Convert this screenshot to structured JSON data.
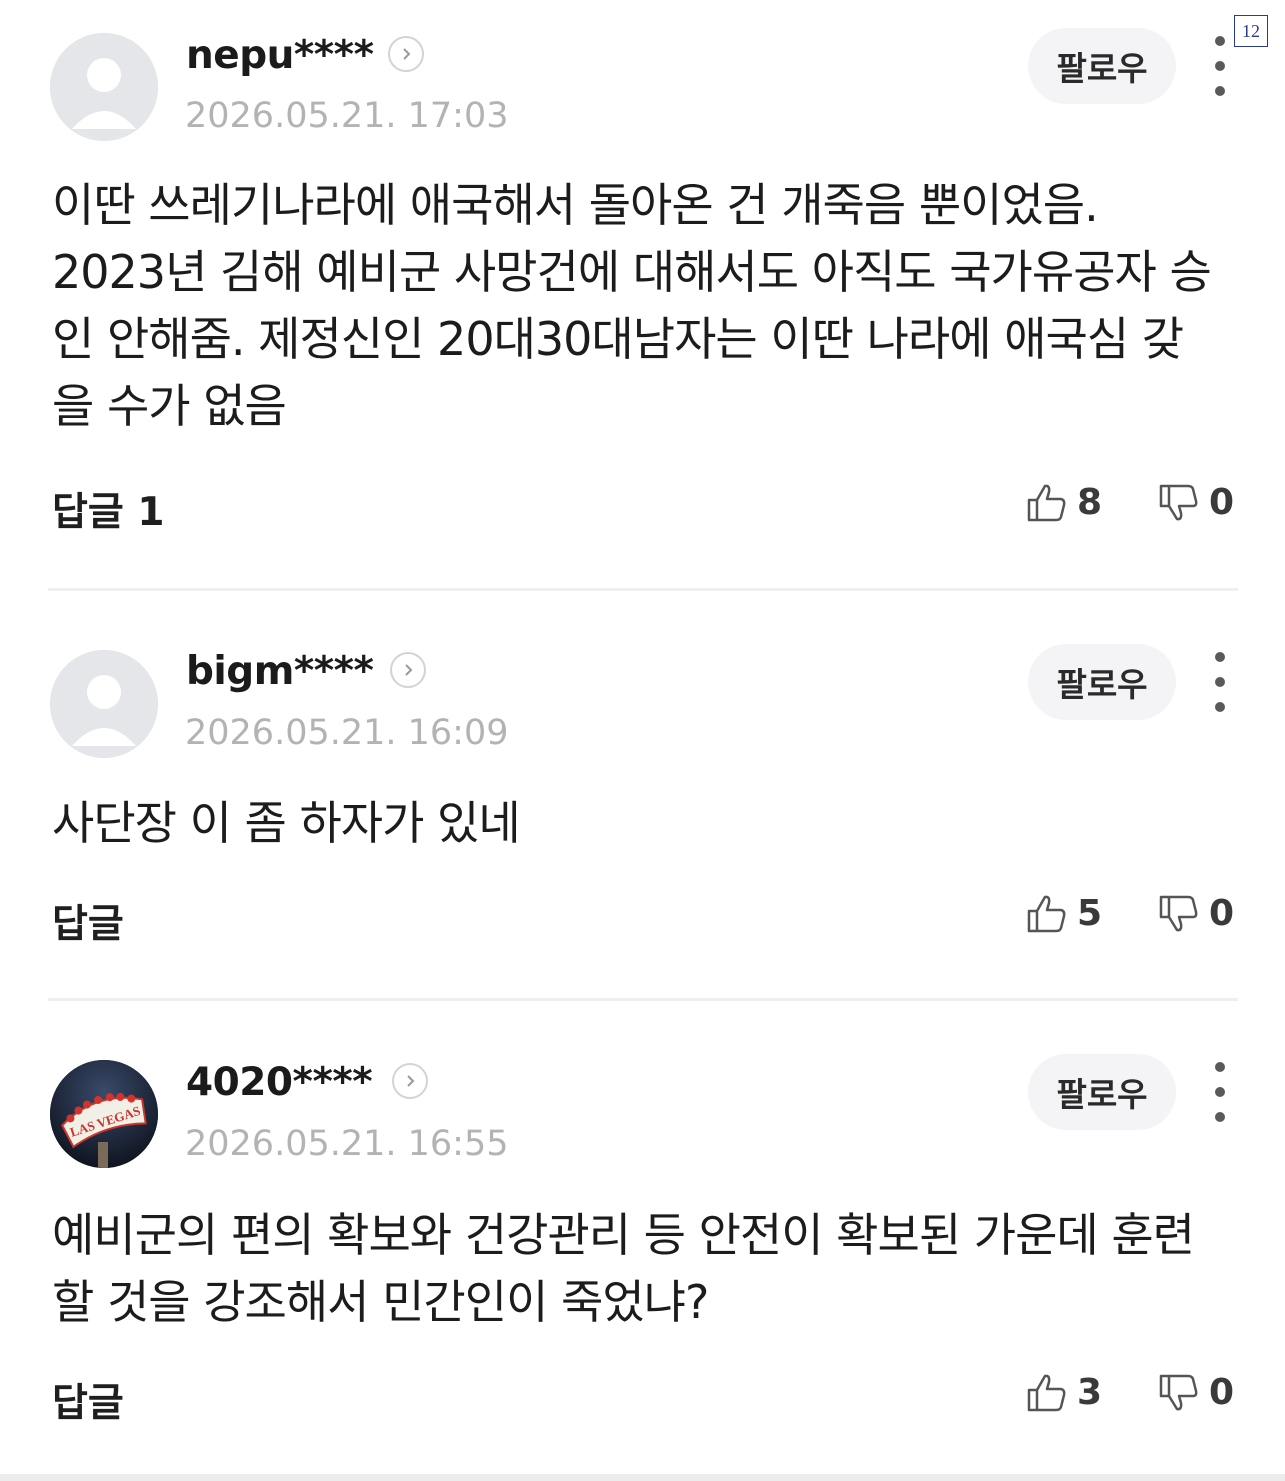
{
  "page_badge": "12",
  "comments": [
    {
      "username": "nepu****",
      "date": "2026.05.21. 17:03",
      "follow_label": "팔로우",
      "avatar": "default-avatar",
      "text": "이딴 쓰레기나라에 애국해서 돌아온 건 개죽음 뿐이었음. 2023년 김해 예비군 사망건에 대해서도 아직도 국가유공자 승인 안해줌. 제정신인 20대30대남자는 이딴 나라에 애국심 갖을 수가 없음",
      "reply_label": "답글 1",
      "likes": "8",
      "dislikes": "0"
    },
    {
      "username": "bigm****",
      "date": "2026.05.21. 16:09",
      "follow_label": "팔로우",
      "avatar": "default-avatar",
      "text": "사단장 이 좀 하자가 있네",
      "reply_label": "답글",
      "likes": "5",
      "dislikes": "0"
    },
    {
      "username": "4020****",
      "date": "2026.05.21. 16:55",
      "follow_label": "팔로우",
      "avatar": "las-vegas-sign-photo",
      "avatar_text": "LAS VEGAS",
      "text": "예비군의 편의 확보와 건강관리 등 안전이 확보된 가운데 훈련할 것을 강조해서 민간인이 죽었냐?",
      "reply_label": "답글",
      "likes": "3",
      "dislikes": "0"
    }
  ],
  "icons": {
    "thumb_up": "thumbs-up-icon",
    "thumb_down": "thumbs-down-icon",
    "chevron": "chevron-right-icon",
    "more": "more-vertical-icon"
  }
}
